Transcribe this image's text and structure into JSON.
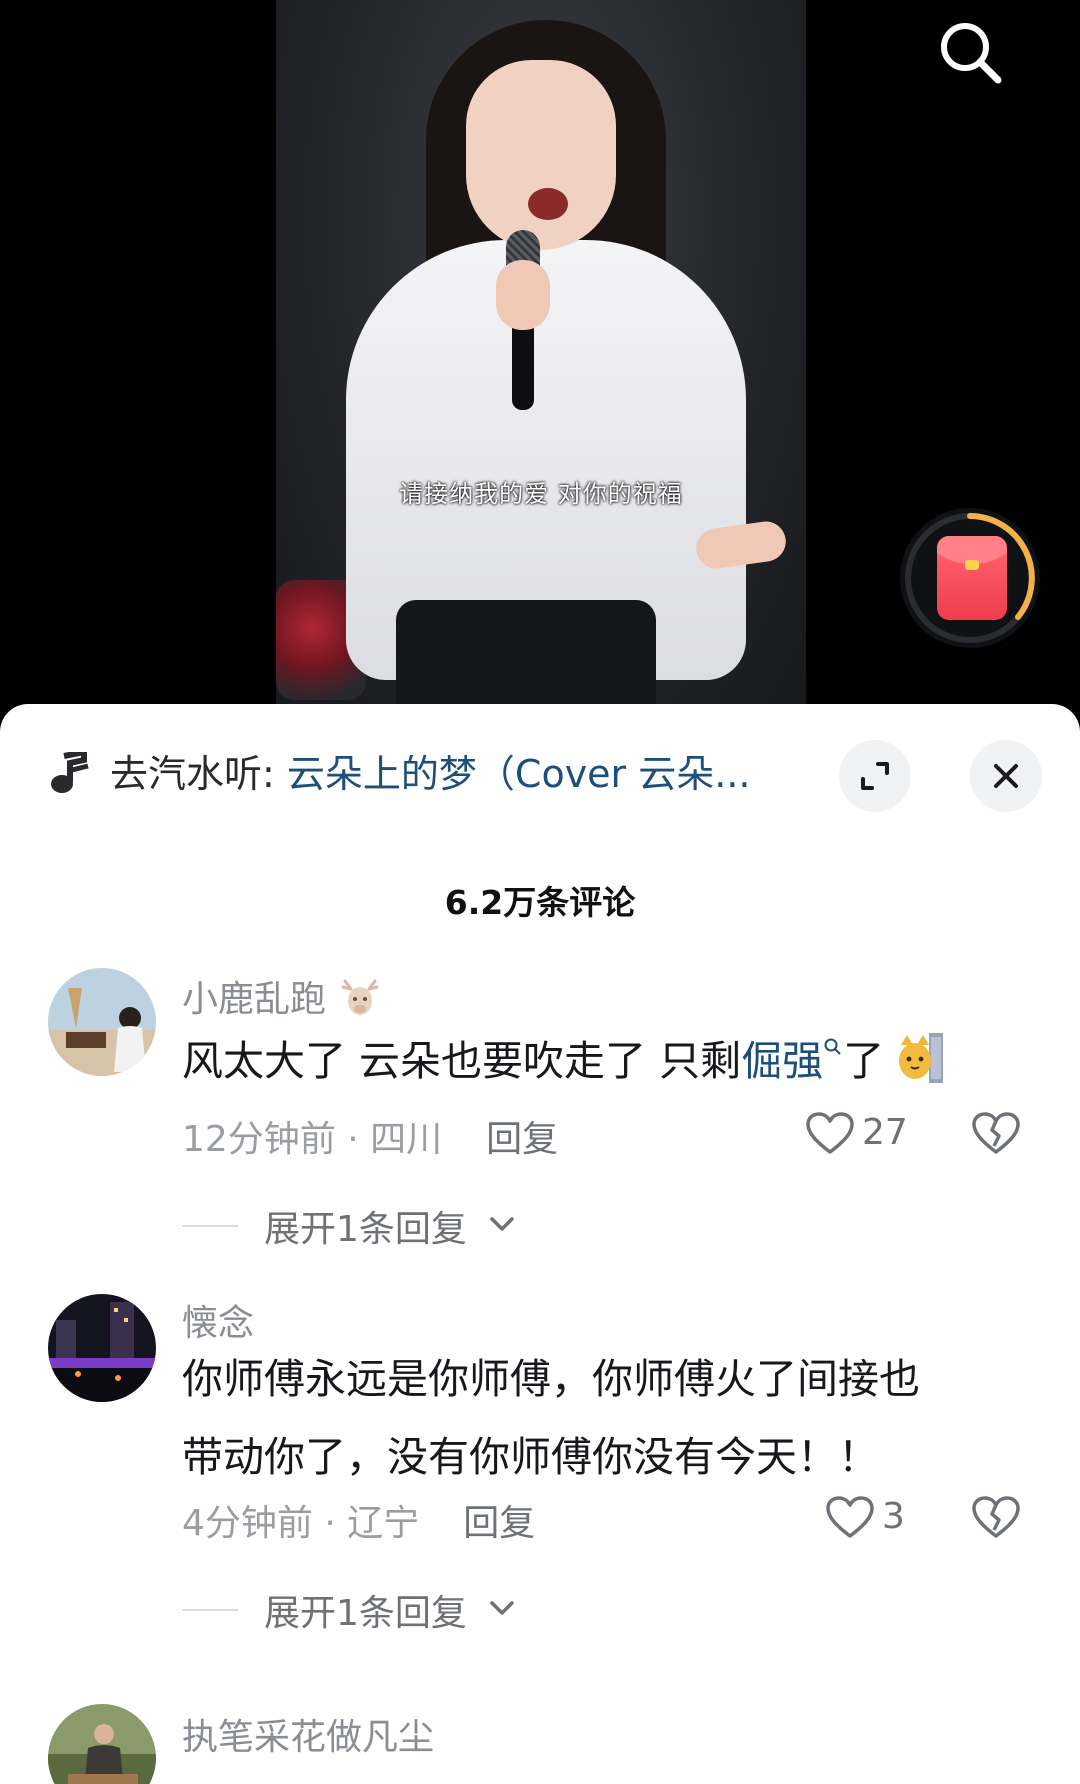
{
  "video": {
    "subtitle": "请接纳我的爱 对你的祝福"
  },
  "icons": {
    "search": "search-icon",
    "red_packet": "red-packet-icon",
    "music_note": "music-note-icon",
    "expand": "expand-icon",
    "close": "close-icon",
    "heart": "heart-icon",
    "broken_heart": "broken-heart-icon",
    "chevron": "chevron-down-icon"
  },
  "colors": {
    "link_blue": "#1d4f7a",
    "meta_gray": "#9a9da3",
    "sheet_bg": "#ffffff"
  },
  "music": {
    "prefix": "去汽水听:",
    "song": "云朵上的梦（Cover 云朵..."
  },
  "comments_header": {
    "count_label": "6.2万条评论"
  },
  "comments": [
    {
      "username": "小鹿乱跑",
      "badge_icon": "deer-emoji-icon",
      "text_before": "风太大了 云朵也要吹走了 只剩",
      "keyword": "倔强",
      "keyword_icon": "search-mini-icon",
      "text_after": "了",
      "trailing_emoji": "cat-peek-emoji-icon",
      "time": "12分钟前",
      "location": "四川",
      "reply_label": "回复",
      "likes": "27",
      "expand_label": "展开1条回复"
    },
    {
      "username": "懐念",
      "text_line1": "你师傅永远是你师傅，你师傅火了间接也",
      "text_line2": "带动你了，没有你师傅你没有今天！！",
      "time": "4分钟前",
      "location": "辽宁",
      "reply_label": "回复",
      "likes": "3",
      "expand_label": "展开1条回复"
    },
    {
      "username": "执笔采花做凡尘"
    }
  ]
}
